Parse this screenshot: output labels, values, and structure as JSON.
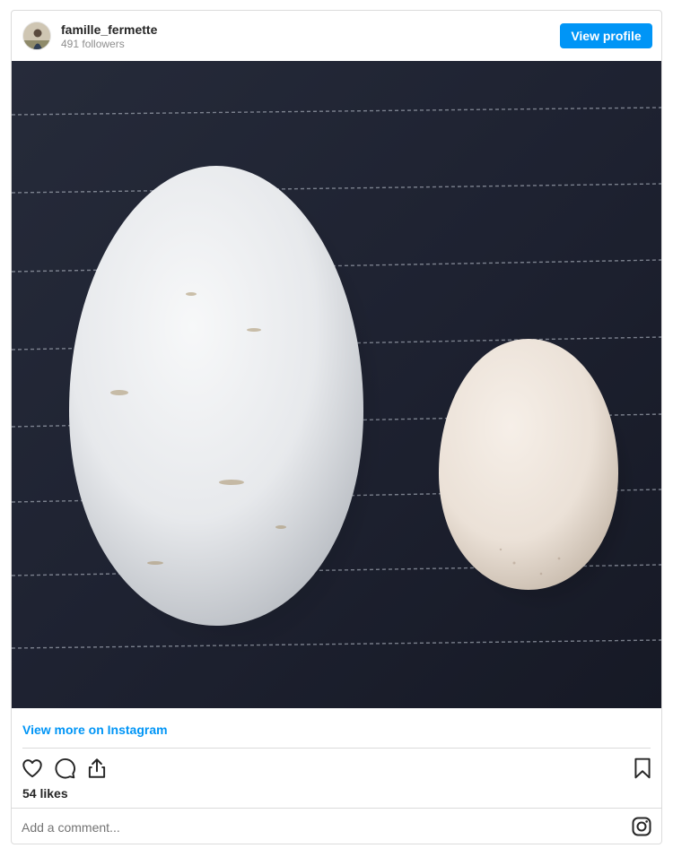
{
  "header": {
    "username": "famille_fermette",
    "followers": "491 followers",
    "view_profile_label": "View profile"
  },
  "post": {
    "photo": "two eggs on dark striped cloth",
    "view_more_label": "View more on Instagram",
    "likes": "54 likes",
    "comment_placeholder": "Add a comment..."
  },
  "icons": {
    "like": "heart-icon",
    "comment": "comment-icon",
    "share": "share-icon",
    "save": "bookmark-icon",
    "instagram": "instagram-logo-icon"
  },
  "colors": {
    "accent": "#0095f6",
    "text": "#262626",
    "muted": "#8e8e8e",
    "border": "#dbdbdb",
    "cloth": "#1f2433"
  }
}
